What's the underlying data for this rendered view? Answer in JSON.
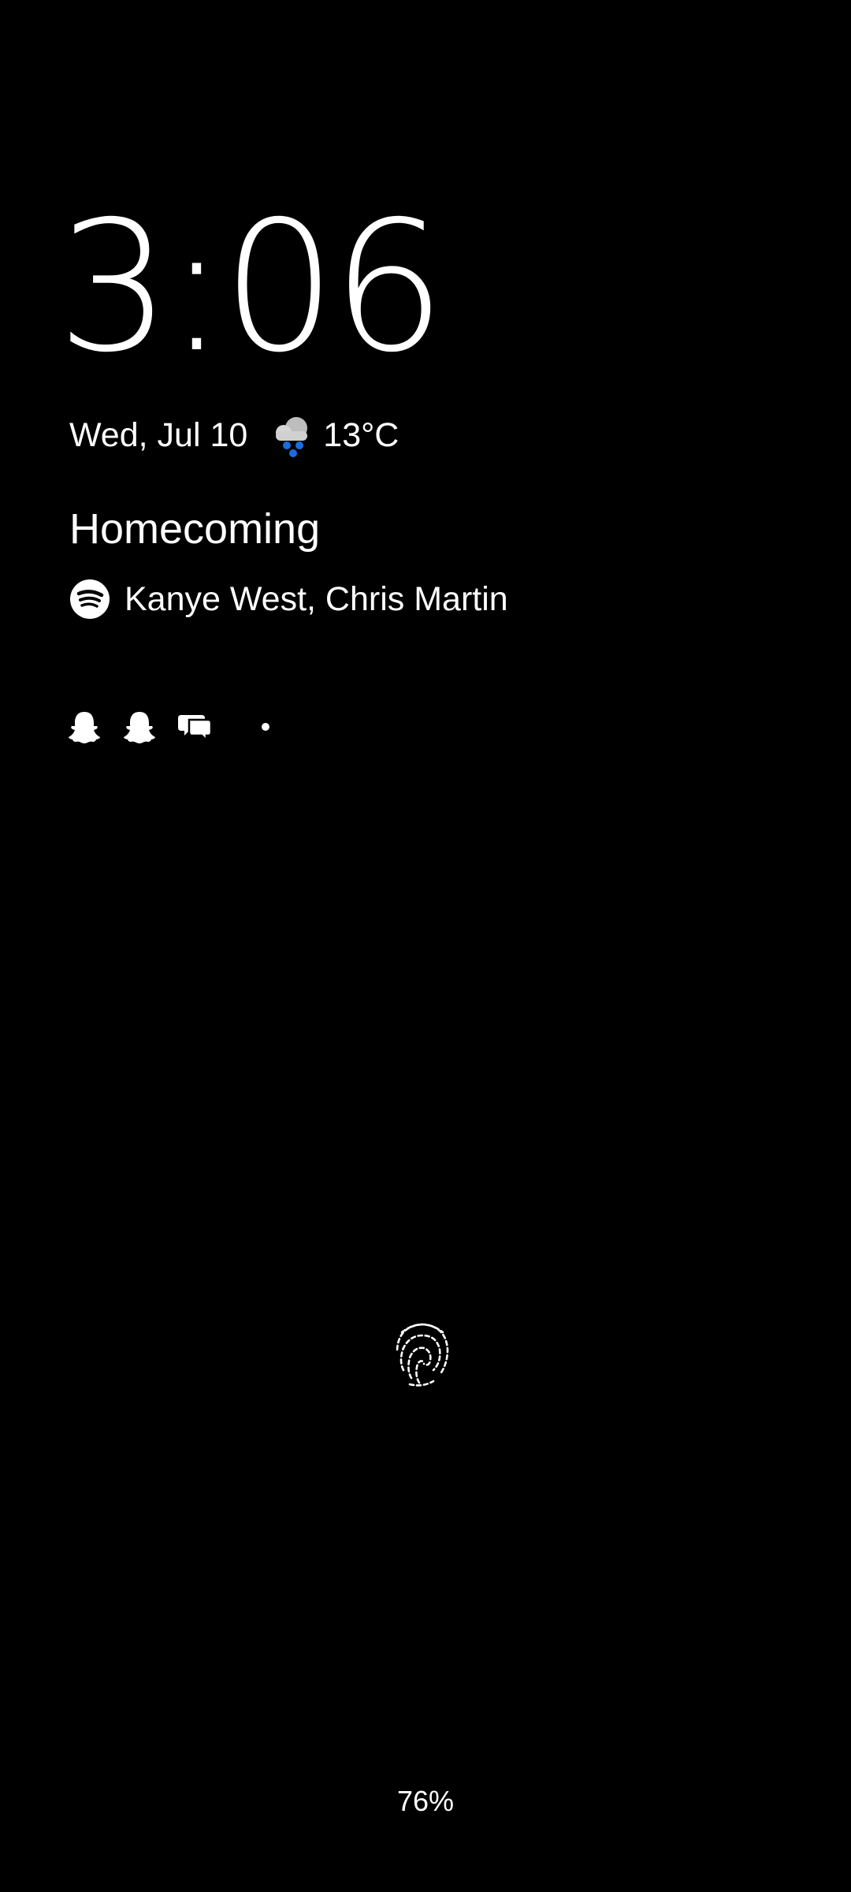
{
  "clock": {
    "time": "3:06"
  },
  "date_weather": {
    "date": "Wed, Jul 10",
    "weather_icon": "rain-cloud-icon",
    "temperature": "13°C"
  },
  "media": {
    "title": "Homecoming",
    "app_icon": "spotify-icon",
    "artist": "Kanye West, Chris Martin"
  },
  "notifications": {
    "icons": [
      "snapchat-icon",
      "snapchat-icon",
      "messages-icon"
    ],
    "overflow": "dot"
  },
  "fingerprint": {
    "icon": "fingerprint-icon"
  },
  "battery": {
    "level": "76%"
  },
  "colors": {
    "background": "#000000",
    "text": "#ffffff",
    "weather_rain": "#1a6de0"
  }
}
